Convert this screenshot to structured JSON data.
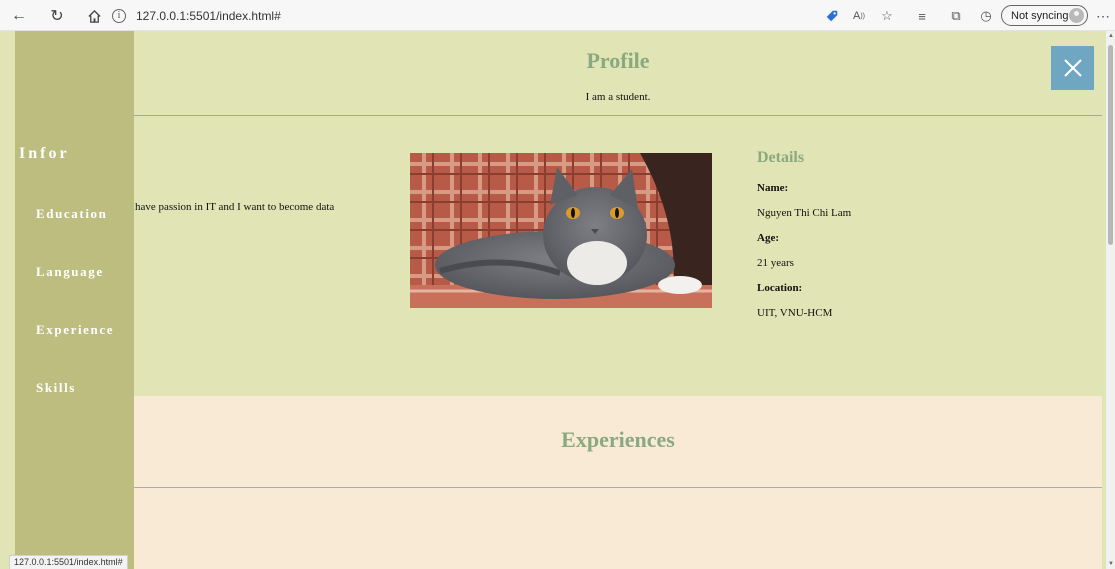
{
  "browser": {
    "url": "127.0.0.1:5501/index.html#",
    "info_icon": "i",
    "sync_label": "Not syncing",
    "status_url": "127.0.0.1:5501/index.html#"
  },
  "sidebar": {
    "title": "Infor",
    "items": [
      {
        "label": "Education"
      },
      {
        "label": "Language"
      },
      {
        "label": "Experience"
      },
      {
        "label": "Skills"
      }
    ]
  },
  "profile": {
    "title": "Profile",
    "subtitle": "I am a student.",
    "passion": "have passion in IT and I want to become data",
    "details": {
      "title": "Details",
      "name_label": "Name:",
      "name_value": "Nguyen Thi Chi Lam",
      "age_label": "Age:",
      "age_value": "21 years",
      "location_label": "Location:",
      "location_value": "UIT, VNU-HCM"
    }
  },
  "experience": {
    "title": "Experiences"
  },
  "colors": {
    "sidebar": "#bebd80",
    "profile_bg": "#e1e4b4",
    "experience_bg": "#f9ead6",
    "heading": "#8aa97e",
    "close_button": "#6fa7c3"
  },
  "icons": {
    "close": "close-icon",
    "back": "back-arrow-icon",
    "refresh": "refresh-icon",
    "home": "home-icon"
  }
}
